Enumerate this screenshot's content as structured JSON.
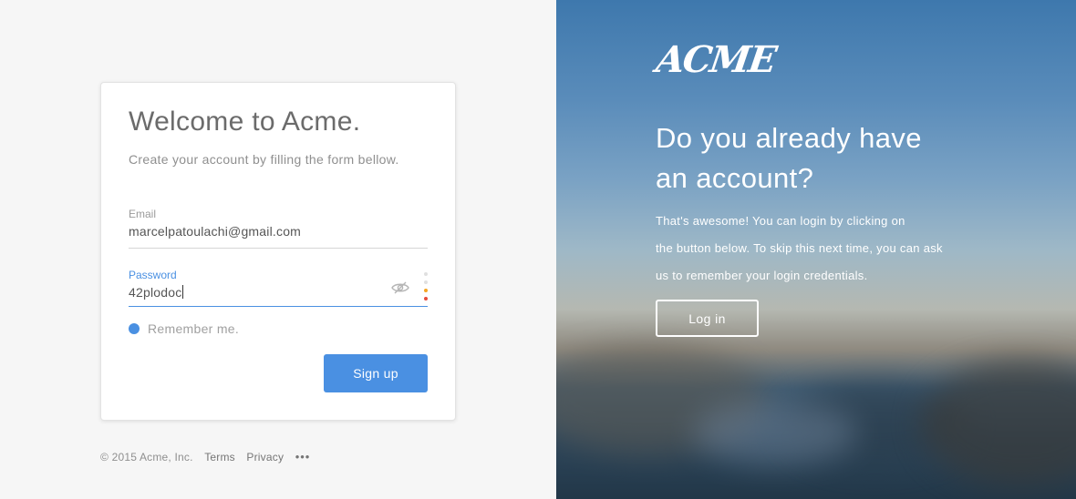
{
  "signup_form": {
    "title": "Welcome to Acme.",
    "subtitle": "Create your account by filling the form bellow.",
    "email": {
      "label": "Email",
      "value": "marcelpatoulachi@gmail.com"
    },
    "password": {
      "label": "Password",
      "value": "42plodoc"
    },
    "remember_label": "Remember me.",
    "remember_checked": true,
    "signup_label": "Sign up",
    "password_strength_colors": [
      "#e0e0e0",
      "#e0e0e0",
      "#f5a623",
      "#e74c3c"
    ]
  },
  "footer": {
    "copyright": "© 2015 Acme, Inc.",
    "terms_label": "Terms",
    "privacy_label": "Privacy",
    "more_label": "•••"
  },
  "login_panel": {
    "logo_text": "ACME",
    "headline_line1": "Do you already have",
    "headline_line2": "an account?",
    "desc_line1": "That's awesome! You can login by clicking on",
    "desc_line2": "the button below. To skip this next time, you can ask",
    "desc_line3": "us to remember your login credentials.",
    "login_label": "Log in"
  },
  "colors": {
    "accent": "#4a90e2",
    "page_background": "#f6f6f6"
  }
}
